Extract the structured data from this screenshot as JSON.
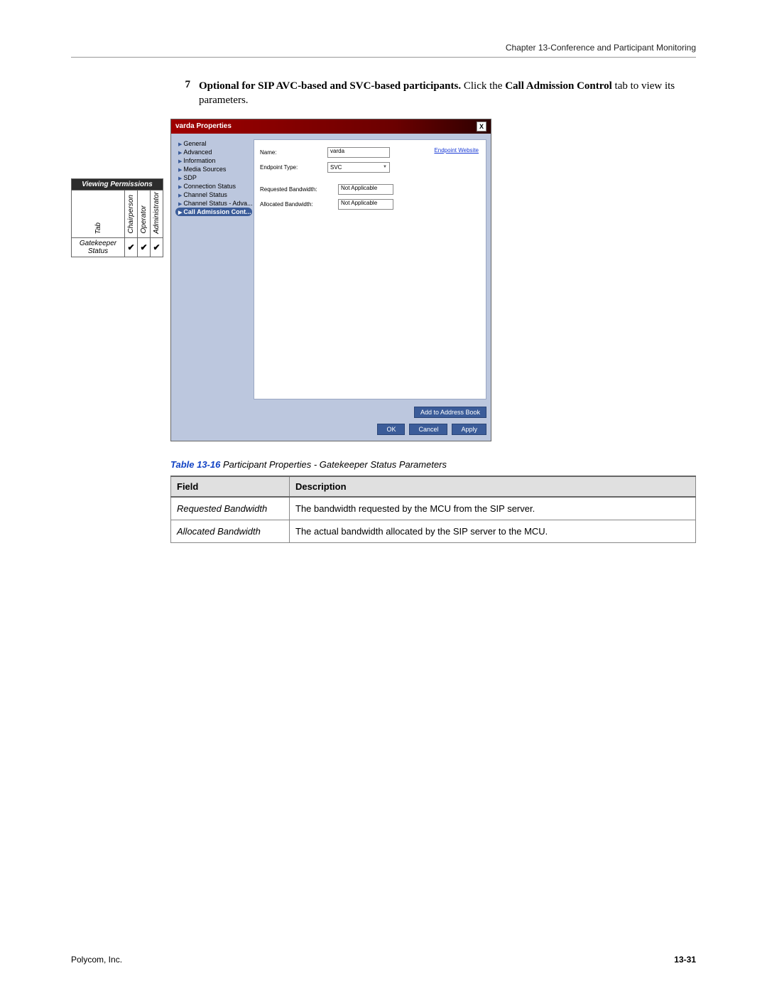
{
  "header": {
    "right": "Chapter 13-Conference and Participant Monitoring"
  },
  "step": {
    "num": "7",
    "bold1": "Optional for SIP AVC-based and SVC-based participants.",
    "mid": " Click the ",
    "bold2": "Call Admission Control",
    "tail": " tab to view its parameters."
  },
  "perm": {
    "header": "Viewing Permissions",
    "tab": "Tab",
    "cols": [
      "Chairperson",
      "Operator",
      "Administrator"
    ],
    "row_label": "Gatekeeper Status",
    "checks": [
      "✔",
      "✔",
      "✔"
    ]
  },
  "dialog": {
    "title": "varda Properties",
    "close": "X",
    "tree": [
      "General",
      "Advanced",
      "Information",
      "Media Sources",
      "SDP",
      "Connection Status",
      "Channel Status",
      "Channel Status - Adva..."
    ],
    "tree_selected": "Call Admission Cont...",
    "form": {
      "name_lab": "Name:",
      "name_val": "varda",
      "website": "Endpoint Website",
      "type_lab": "Endpoint Type:",
      "type_val": "SVC",
      "req_lab": "Requested Bandwidth:",
      "req_val": "Not Applicable",
      "alloc_lab": "Allocated Bandwidth:",
      "alloc_val": "Not Applicable"
    },
    "buttons": {
      "add": "Add to Address Book",
      "ok": "OK",
      "cancel": "Cancel",
      "apply": "Apply"
    }
  },
  "table": {
    "num": "Table 13-16",
    "caption": "Participant Properties - Gatekeeper Status Parameters",
    "headers": [
      "Field",
      "Description"
    ],
    "rows": [
      {
        "field": "Requested Bandwidth",
        "desc": "The bandwidth requested by the MCU from the SIP server."
      },
      {
        "field": "Allocated Bandwidth",
        "desc": "The actual bandwidth allocated by the SIP server to the MCU."
      }
    ]
  },
  "footer": {
    "left": "Polycom, Inc.",
    "right": "13-31"
  }
}
